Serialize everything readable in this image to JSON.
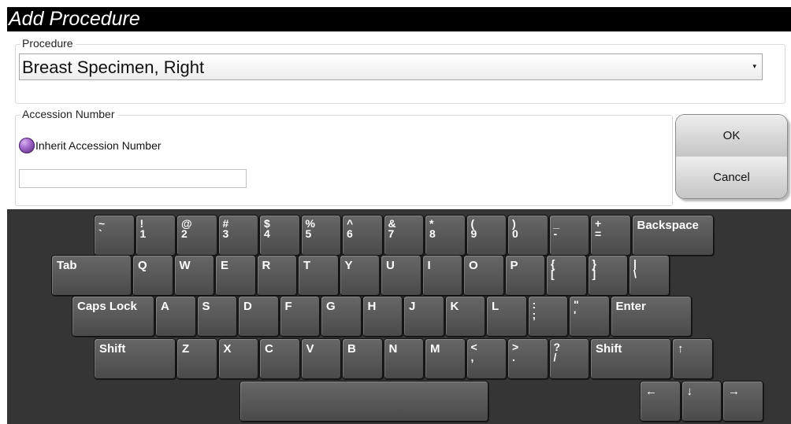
{
  "window": {
    "title": "Add Procedure"
  },
  "procedure": {
    "legend": "Procedure",
    "selected": "Breast Specimen, Right",
    "arrow": "▾"
  },
  "accession": {
    "legend": "Accession Number",
    "inherit_label": "Inherit Accession Number",
    "value": ""
  },
  "actions": {
    "ok": "OK",
    "cancel": "Cancel"
  },
  "keyboard": {
    "rows": [
      [
        {
          "top": "~",
          "bottom": "`",
          "name": "key-tilde"
        },
        {
          "top": "!",
          "bottom": "1",
          "name": "key-1"
        },
        {
          "top": "@",
          "bottom": "2",
          "name": "key-2"
        },
        {
          "top": "#",
          "bottom": "3",
          "name": "key-3"
        },
        {
          "top": "$",
          "bottom": "4",
          "name": "key-4"
        },
        {
          "top": "%",
          "bottom": "5",
          "name": "key-5"
        },
        {
          "top": "^",
          "bottom": "6",
          "name": "key-6"
        },
        {
          "top": "&",
          "bottom": "7",
          "name": "key-7"
        },
        {
          "top": "*",
          "bottom": "8",
          "name": "key-8"
        },
        {
          "top": "(",
          "bottom": "9",
          "name": "key-9"
        },
        {
          "top": ")",
          "bottom": "0",
          "name": "key-0"
        },
        {
          "top": "_",
          "bottom": "-",
          "name": "key-minus"
        },
        {
          "top": "+",
          "bottom": "=",
          "name": "key-equals"
        },
        {
          "label": "Backspace",
          "name": "key-backspace"
        }
      ],
      [
        {
          "label": "Tab",
          "name": "key-tab"
        },
        {
          "label": "Q",
          "name": "key-q"
        },
        {
          "label": "W",
          "name": "key-w"
        },
        {
          "label": "E",
          "name": "key-e"
        },
        {
          "label": "R",
          "name": "key-r"
        },
        {
          "label": "T",
          "name": "key-t"
        },
        {
          "label": "Y",
          "name": "key-y"
        },
        {
          "label": "U",
          "name": "key-u"
        },
        {
          "label": "I",
          "name": "key-i"
        },
        {
          "label": "O",
          "name": "key-o"
        },
        {
          "label": "P",
          "name": "key-p"
        },
        {
          "top": "{",
          "bottom": "[",
          "name": "key-left-bracket"
        },
        {
          "top": "}",
          "bottom": "]",
          "name": "key-right-bracket"
        },
        {
          "top": "|",
          "bottom": "\\",
          "name": "key-backslash"
        }
      ],
      [
        {
          "label": "Caps Lock",
          "name": "key-caps-lock"
        },
        {
          "label": "A",
          "name": "key-a"
        },
        {
          "label": "S",
          "name": "key-s"
        },
        {
          "label": "D",
          "name": "key-d"
        },
        {
          "label": "F",
          "name": "key-f"
        },
        {
          "label": "G",
          "name": "key-g"
        },
        {
          "label": "H",
          "name": "key-h"
        },
        {
          "label": "J",
          "name": "key-j"
        },
        {
          "label": "K",
          "name": "key-k"
        },
        {
          "label": "L",
          "name": "key-l"
        },
        {
          "top": ":",
          "bottom": ";",
          "name": "key-semicolon"
        },
        {
          "top": "\"",
          "bottom": "'",
          "name": "key-quote"
        },
        {
          "label": "Enter",
          "name": "key-enter"
        }
      ],
      [
        {
          "label": "Shift",
          "name": "key-left-shift"
        },
        {
          "label": "Z",
          "name": "key-z"
        },
        {
          "label": "X",
          "name": "key-x"
        },
        {
          "label": "C",
          "name": "key-c"
        },
        {
          "label": "V",
          "name": "key-v"
        },
        {
          "label": "B",
          "name": "key-b"
        },
        {
          "label": "N",
          "name": "key-n"
        },
        {
          "label": "M",
          "name": "key-m"
        },
        {
          "top": "<",
          "bottom": ",",
          "name": "key-comma"
        },
        {
          "top": ">",
          "bottom": ".",
          "name": "key-period"
        },
        {
          "top": "?",
          "bottom": "/",
          "name": "key-slash"
        },
        {
          "label": "Shift",
          "name": "key-right-shift"
        },
        {
          "label": "↑",
          "name": "key-arrow-up"
        }
      ],
      [
        {
          "label": "",
          "name": "key-space"
        },
        {
          "label": "←",
          "name": "key-arrow-left"
        },
        {
          "label": "↓",
          "name": "key-arrow-down"
        },
        {
          "label": "→",
          "name": "key-arrow-right"
        }
      ]
    ]
  }
}
